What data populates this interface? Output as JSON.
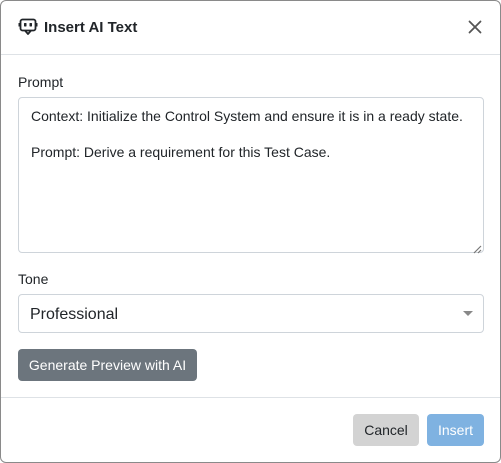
{
  "dialog": {
    "title": "Insert AI Text",
    "icon": "ai-chat-icon",
    "close_icon": "close-icon"
  },
  "prompt": {
    "label": "Prompt",
    "value": "Context: Initialize the Control System and ensure it is in a ready state.\n\nPrompt: Derive a requirement for this Test Case."
  },
  "tone": {
    "label": "Tone",
    "selected": "Professional"
  },
  "actions": {
    "generate_label": "Generate Preview with AI",
    "cancel_label": "Cancel",
    "insert_label": "Insert"
  },
  "colors": {
    "secondary": "#6c757d",
    "cancel": "#d3d3d3",
    "insert_disabled": "#7fb2e1"
  }
}
